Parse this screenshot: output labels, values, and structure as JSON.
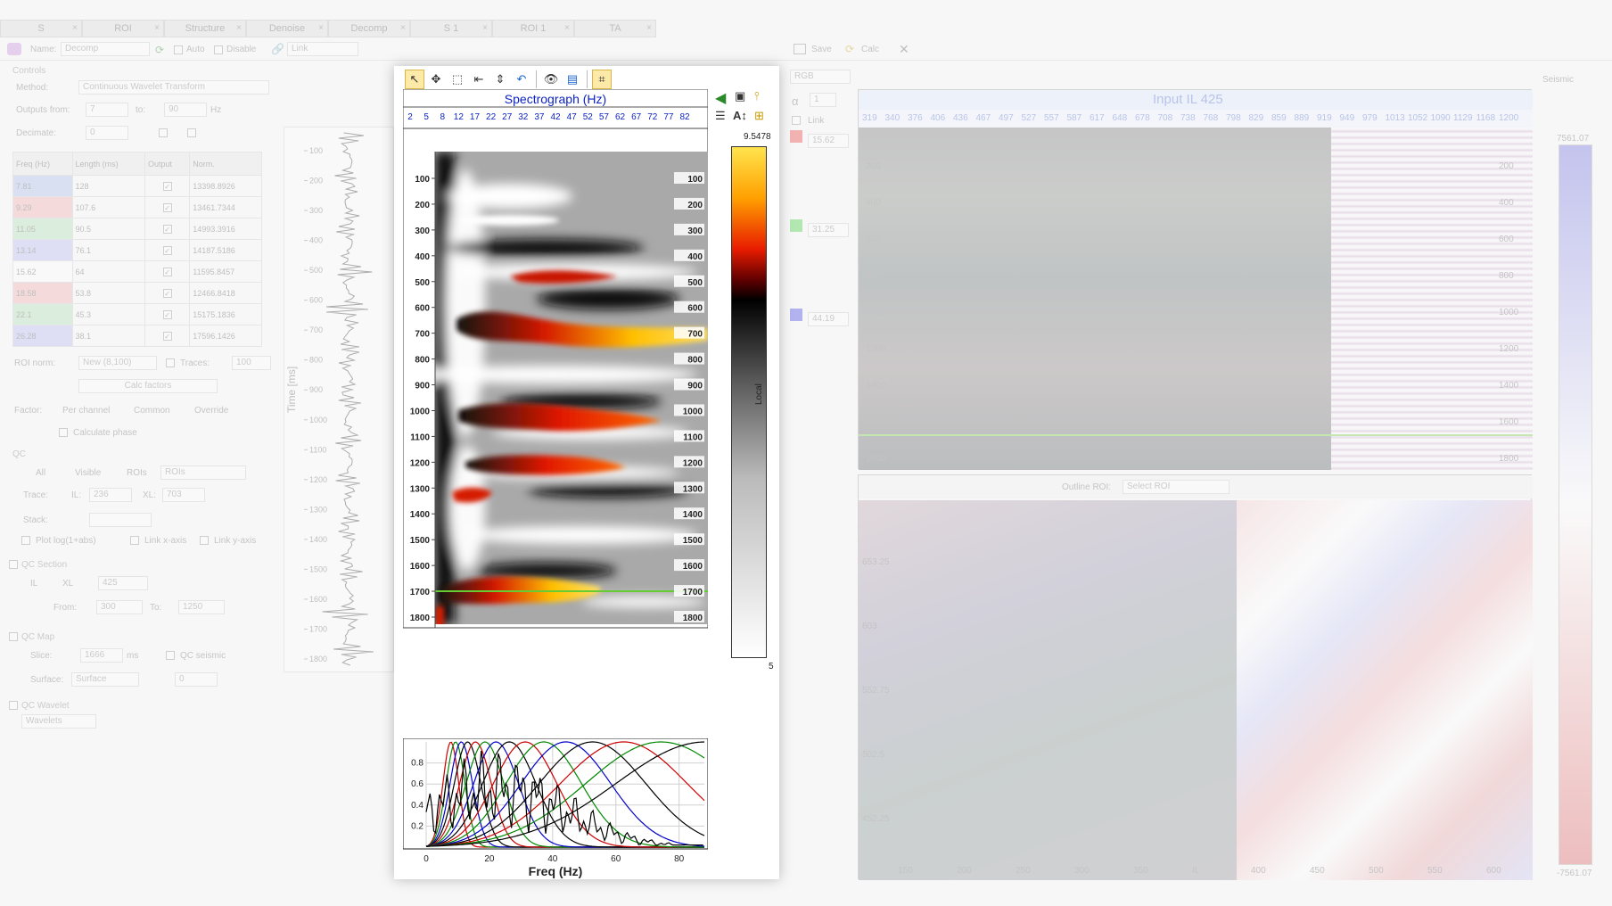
{
  "tabs": [
    {
      "label": "S"
    },
    {
      "label": "ROI"
    },
    {
      "label": "Structure"
    },
    {
      "label": "Denoise"
    },
    {
      "label": "Decomp"
    },
    {
      "label": "S 1"
    },
    {
      "label": "ROI 1"
    },
    {
      "label": "TA"
    }
  ],
  "controls": {
    "name_label": "Name:",
    "name_value": "Decomp",
    "auto_label": "Auto",
    "disable_label": "Disable",
    "link_label": "Link",
    "section_title": "Controls",
    "method_label": "Method:",
    "method_value": "Continuous Wavelet Transform",
    "outputs_from_label": "Outputs from:",
    "outputs_from": "7",
    "outputs_to_label": "to:",
    "outputs_to": "90",
    "hz_label": "Hz",
    "decimate_label": "Decimate:",
    "decimate_value": "0",
    "table_headers": [
      "Freq (Hz)",
      "Length (ms)",
      "Output",
      "Norm."
    ],
    "rows": [
      {
        "freq": "7.81",
        "length": "128",
        "norm": "13398.8926",
        "color": "#9fb8e8"
      },
      {
        "freq": "9.29",
        "length": "107.6",
        "norm": "13461.7344",
        "color": "#f0a7a7"
      },
      {
        "freq": "11.05",
        "length": "90.5",
        "norm": "14993.3916",
        "color": "#a9dca9"
      },
      {
        "freq": "13.14",
        "length": "76.1",
        "norm": "14187.5186",
        "color": "#b2b2f0"
      },
      {
        "freq": "15.62",
        "length": "64",
        "norm": "11595.8457",
        "color": "#ffffff"
      },
      {
        "freq": "18.58",
        "length": "53.8",
        "norm": "12466.8418",
        "color": "#f0a7a7"
      },
      {
        "freq": "22.1",
        "length": "45.3",
        "norm": "15175.1836",
        "color": "#a9dca9"
      },
      {
        "freq": "26.28",
        "length": "38.1",
        "norm": "17596.1426",
        "color": "#b2b2f0"
      }
    ],
    "roi_norm_label": "ROI norm:",
    "roi_norm_value": "New (8,100)",
    "traces_label": "Traces:",
    "traces_value": "100",
    "calc_factors_label": "Calc factors",
    "factor_label": "Factor:",
    "factor_options": [
      "Per channel",
      "Common",
      "Override"
    ],
    "calc_phase_label": "Calculate phase",
    "qc_title": "QC",
    "qc_options": [
      "All",
      "Visible",
      "ROIs"
    ],
    "qc_rois_value": "ROIs",
    "trace_label": "Trace:",
    "il_label": "IL:",
    "il_value": "236",
    "xl_label": "XL:",
    "xl_value": "703",
    "stack_label": "Stack:",
    "plot_log_label": "Plot log(1+abs)",
    "link_x_label": "Link x-axis",
    "link_y_label": "Link y-axis",
    "qc_section_title": "QC Section",
    "section_il": "IL",
    "section_xl": "XL",
    "section_value": "425",
    "from_label": "From:",
    "from_value": "300",
    "to_label": "To:",
    "to_value": "1250",
    "qc_map_title": "QC Map",
    "slice_label": "Slice:",
    "slice_value": "1666",
    "ms_label": "ms",
    "qc_seismic_label": "QC seismic",
    "surface_label": "Surface:",
    "surface_value": "Surface",
    "surface_offset": "0",
    "qc_wavelet_title": "QC Wavelet",
    "wavelet_value": "Wavelets"
  },
  "trace_panel": {
    "ylabel": "Time [ms]",
    "ticks": [
      "100",
      "200",
      "300",
      "400",
      "500",
      "600",
      "700",
      "800",
      "900",
      "1000",
      "1100",
      "1200",
      "1300",
      "1400",
      "1500",
      "1600",
      "1700",
      "1800"
    ]
  },
  "spectrograph": {
    "title": "Spectrograph (Hz)",
    "freq_ticks": [
      "2",
      "5",
      "8",
      "12",
      "17",
      "22",
      "27",
      "32",
      "37",
      "42",
      "47",
      "52",
      "57",
      "62",
      "67",
      "72",
      "77",
      "82"
    ],
    "time_ticks": [
      "100",
      "200",
      "300",
      "400",
      "500",
      "600",
      "700",
      "800",
      "900",
      "1000",
      "1100",
      "1200",
      "1300",
      "1400",
      "1500",
      "1600",
      "1700",
      "1800"
    ],
    "colorbar_max": "9.5478",
    "colorbar_min": "5",
    "colorbar_label": "Local",
    "marker_time_ms": 1700
  },
  "chart_data": {
    "type": "line",
    "title": "",
    "xlabel": "Freq (Hz)",
    "ylabel": "",
    "xlim": [
      0,
      88
    ],
    "ylim": [
      0,
      1
    ],
    "x_ticks": [
      "0",
      "20",
      "40",
      "60",
      "80"
    ],
    "y_ticks": [
      "0.2",
      "0.4",
      "0.6",
      "0.8"
    ],
    "series": [
      {
        "color": "#cc0000",
        "peak_hz": 7.8
      },
      {
        "color": "#008800",
        "peak_hz": 9.3
      },
      {
        "color": "#0000cc",
        "peak_hz": 11.1
      },
      {
        "color": "#000000",
        "peak_hz": 13.1
      },
      {
        "color": "#cc0000",
        "peak_hz": 15.6
      },
      {
        "color": "#008800",
        "peak_hz": 18.6
      },
      {
        "color": "#0000cc",
        "peak_hz": 22.1
      },
      {
        "color": "#000000",
        "peak_hz": 26.3
      },
      {
        "color": "#cc0000",
        "peak_hz": 31.3
      },
      {
        "color": "#008800",
        "peak_hz": 37.2
      },
      {
        "color": "#0000cc",
        "peak_hz": 44.2
      },
      {
        "color": "#000000",
        "peak_hz": 52.6
      },
      {
        "color": "#cc0000",
        "peak_hz": 62.5
      },
      {
        "color": "#008800",
        "peak_hz": 74.3
      },
      {
        "color": "#000000",
        "peak_hz": 88.4
      }
    ]
  },
  "right_panel": {
    "save_label": "Save",
    "calc_label": "Calc",
    "mode_value": "RGB",
    "alpha_label": "α",
    "alpha_value": "1",
    "link_label": "Link",
    "r_value": "15.62",
    "g_value": "31.25",
    "b_value": "44.19",
    "input_title": "Input  IL 425",
    "xl_ticks": [
      "319",
      "340",
      "376",
      "406",
      "436",
      "467",
      "497",
      "527",
      "557",
      "587",
      "617",
      "648",
      "678",
      "708",
      "738",
      "768",
      "798",
      "829",
      "859",
      "889",
      "919",
      "949",
      "979",
      "1013",
      "1052",
      "1090",
      "1129",
      "1168",
      "1200"
    ],
    "time_ticks": [
      "200",
      "400",
      "600",
      "800",
      "1000",
      "1200",
      "1400",
      "1600",
      "1800"
    ],
    "seismic_label": "Seismic",
    "seismic_max": "7561.07",
    "seismic_min": "-7561.07",
    "outline_label": "Outline ROI:",
    "outline_value": "Select ROI",
    "map_y_ticks": [
      "653.25",
      "603",
      "552.75",
      "502.5",
      "452.25"
    ],
    "map_x_ticks": [
      "150",
      "200",
      "250",
      "300",
      "350",
      "IL",
      "400",
      "450",
      "500",
      "550",
      "600"
    ]
  }
}
